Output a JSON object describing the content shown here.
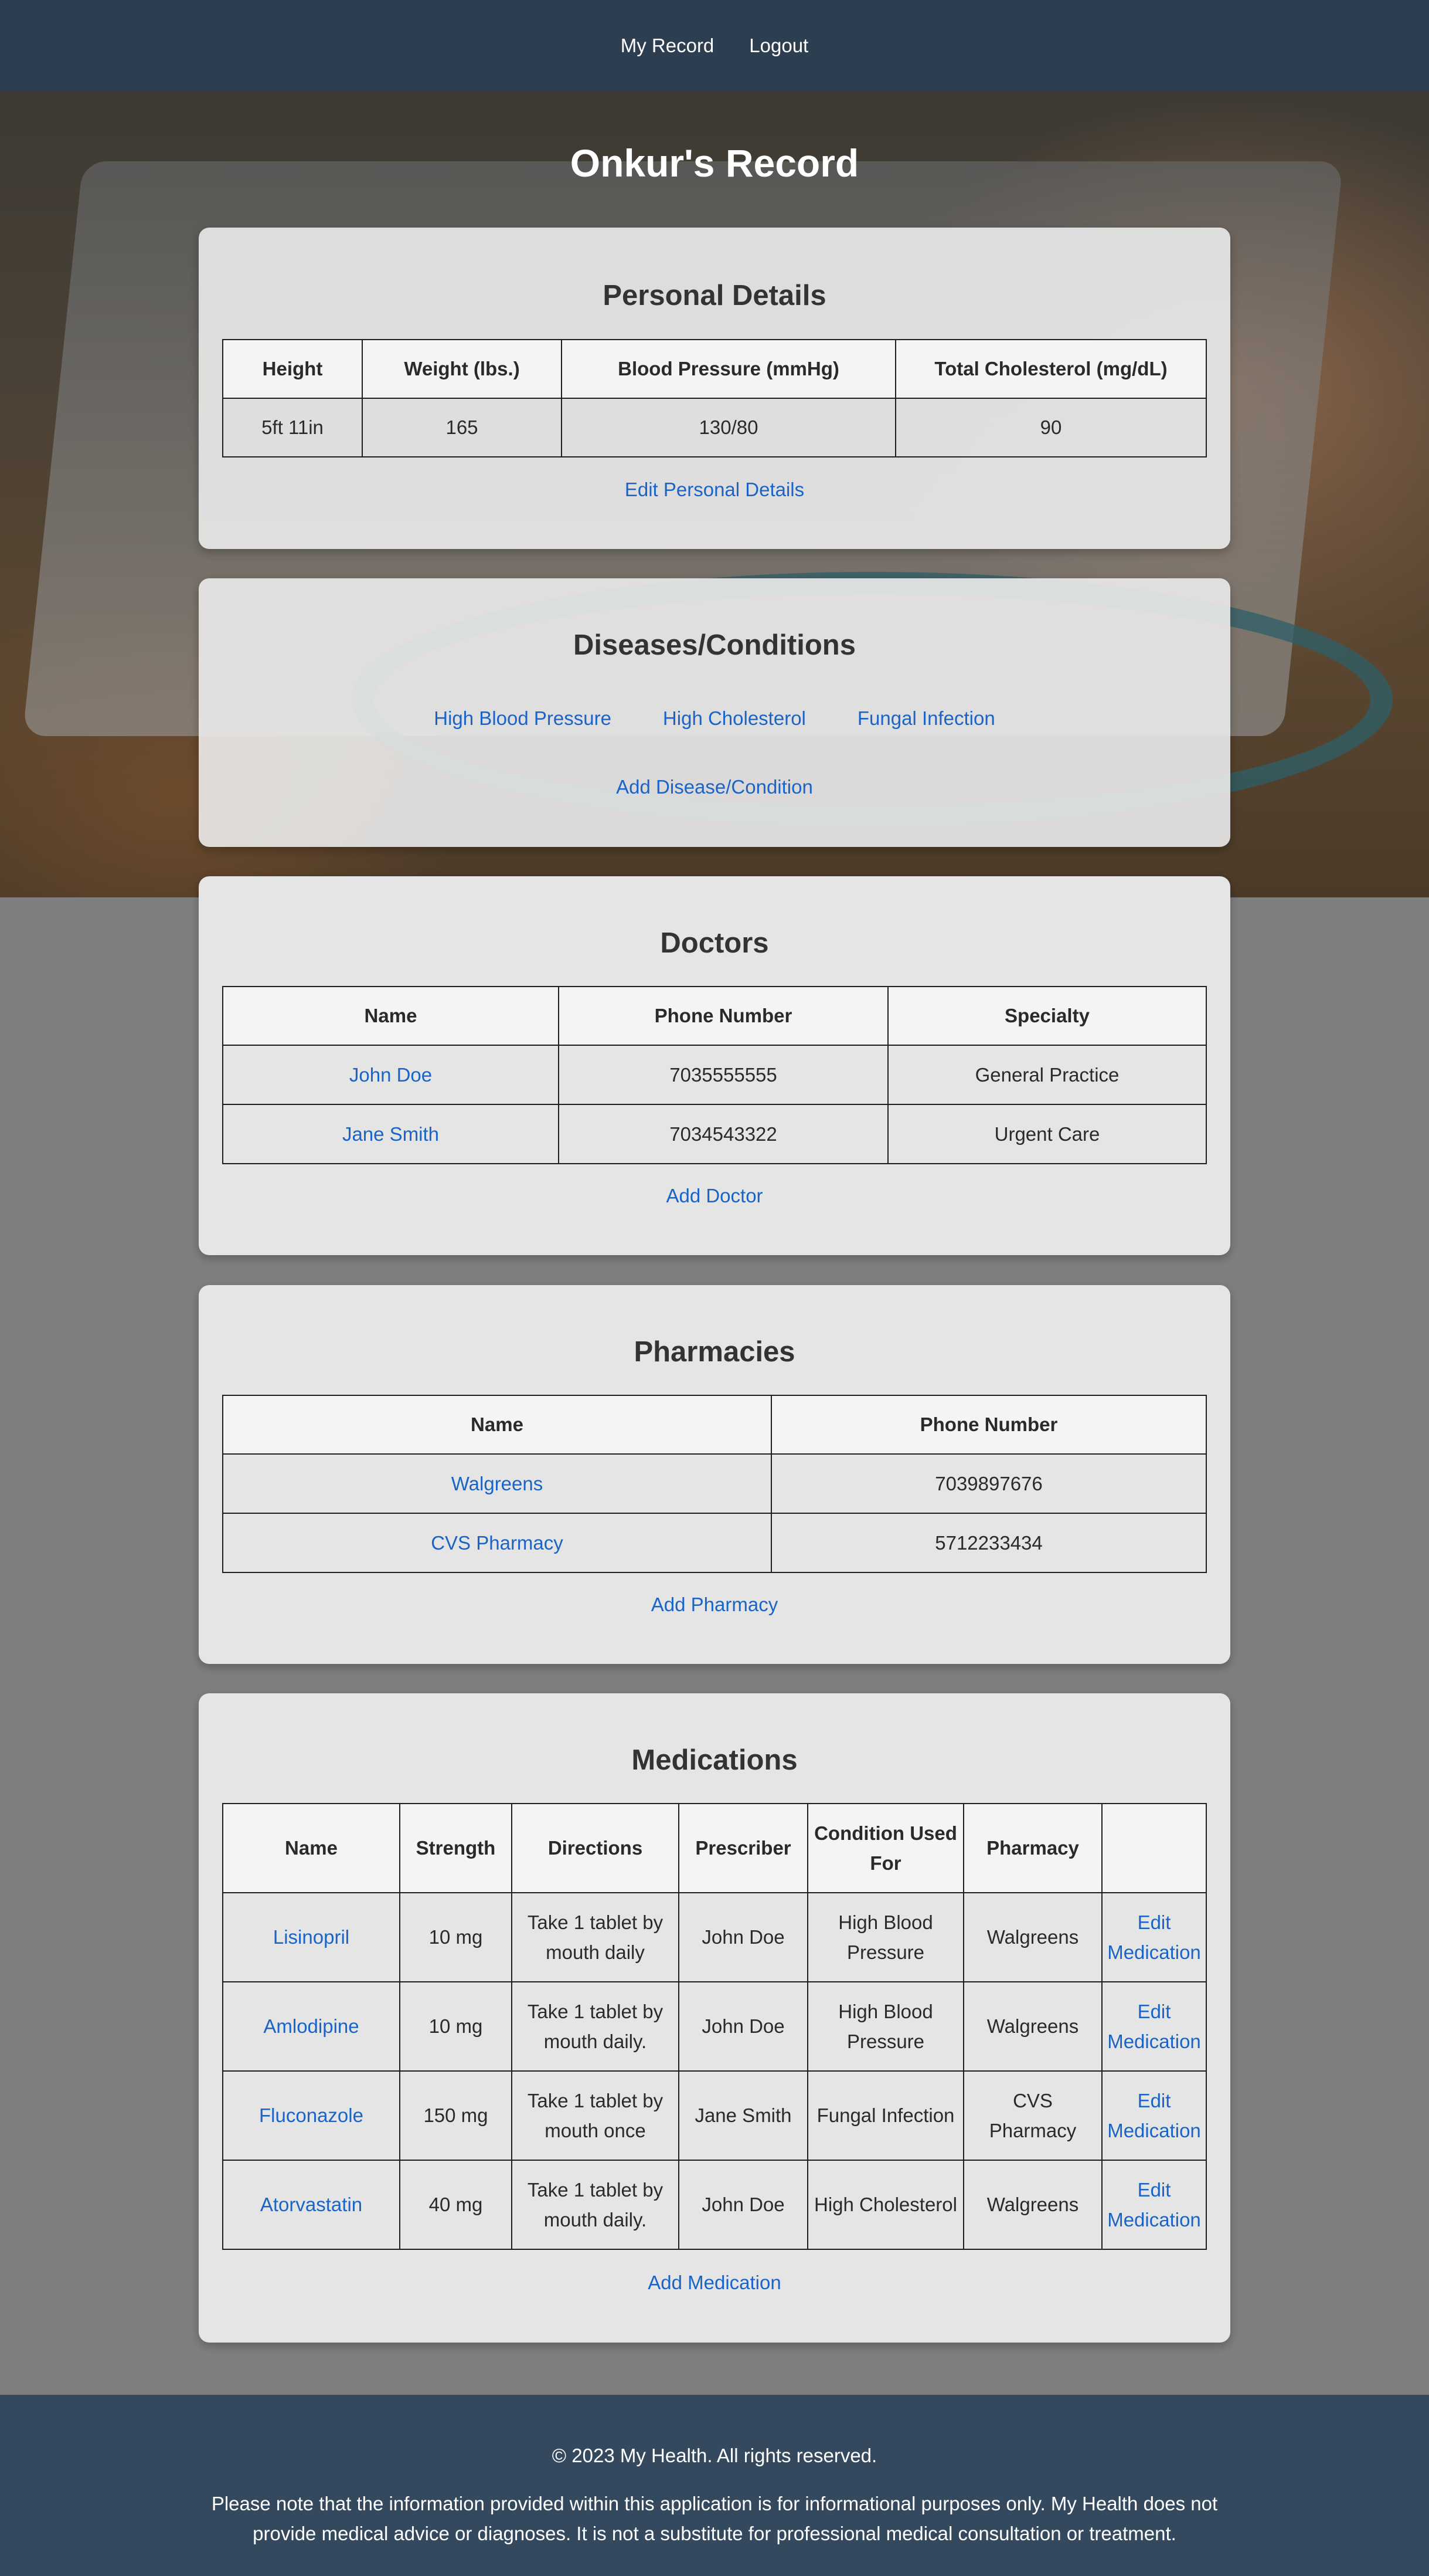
{
  "nav": {
    "my_record": "My Record",
    "logout": "Logout"
  },
  "page_title": "Onkur's Record",
  "personal": {
    "title": "Personal Details",
    "headers": [
      "Height",
      "Weight (lbs.)",
      "Blood Pressure (mmHg)",
      "Total Cholesterol (mg/dL)"
    ],
    "values": [
      "5ft 11in",
      "165",
      "130/80",
      "90"
    ],
    "edit_link": "Edit Personal Details"
  },
  "conditions": {
    "title": "Diseases/Conditions",
    "items": [
      "High Blood Pressure",
      "High Cholesterol",
      "Fungal Infection"
    ],
    "add_link": "Add Disease/Condition"
  },
  "doctors": {
    "title": "Doctors",
    "headers": [
      "Name",
      "Phone Number",
      "Specialty"
    ],
    "rows": [
      [
        "John Doe",
        "7035555555",
        "General Practice"
      ],
      [
        "Jane Smith",
        "7034543322",
        "Urgent Care"
      ]
    ],
    "add_link": "Add Doctor"
  },
  "pharmacies": {
    "title": "Pharmacies",
    "headers": [
      "Name",
      "Phone Number"
    ],
    "rows": [
      [
        "Walgreens",
        "7039897676"
      ],
      [
        "CVS Pharmacy",
        "5712233434"
      ]
    ],
    "add_link": "Add Pharmacy"
  },
  "medications": {
    "title": "Medications",
    "headers": [
      "Name",
      "Strength",
      "Directions",
      "Prescriber",
      "Condition Used For",
      "Pharmacy",
      ""
    ],
    "rows": [
      [
        "Lisinopril",
        "10 mg",
        "Take 1 tablet by mouth daily",
        "John Doe",
        "High Blood Pressure",
        "Walgreens",
        "Edit Medication"
      ],
      [
        "Amlodipine",
        "10 mg",
        "Take 1 tablet by mouth daily.",
        "John Doe",
        "High Blood Pressure",
        "Walgreens",
        "Edit Medication"
      ],
      [
        "Fluconazole",
        "150 mg",
        "Take 1 tablet by mouth once",
        "Jane Smith",
        "Fungal Infection",
        "CVS Pharmacy",
        "Edit Medication"
      ],
      [
        "Atorvastatin",
        "40 mg",
        "Take 1 tablet by mouth daily.",
        "John Doe",
        "High Cholesterol",
        "Walgreens",
        "Edit Medication"
      ]
    ],
    "add_link": "Add Medication"
  },
  "footer": {
    "copyright": "© 2023 My Health. All rights reserved.",
    "disclaimer": "Please note that the information provided within this application is for informational purposes only. My Health does not provide medical advice or diagnoses. It is not a substitute for professional medical consultation or treatment."
  },
  "colors": {
    "navbar": "#2c3e50",
    "footer": "#34495e",
    "link": "#1a64c8",
    "page_background": "#7f7f7f"
  }
}
